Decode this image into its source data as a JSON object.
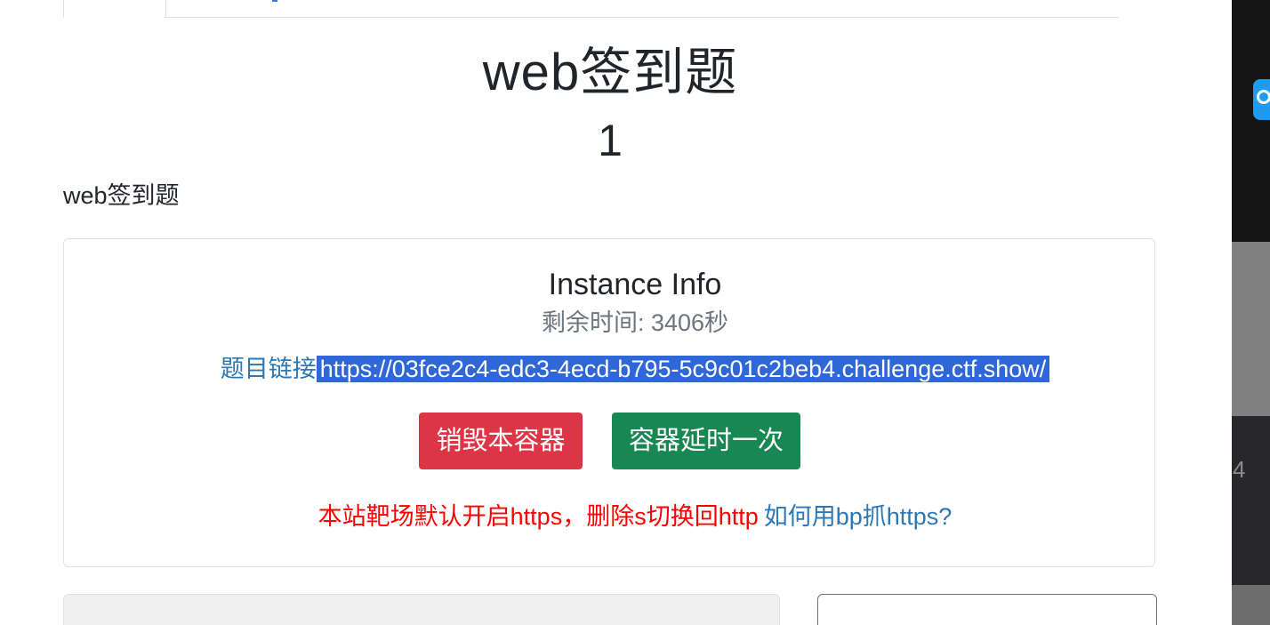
{
  "challenge": {
    "title": "web签到题",
    "value": "1",
    "description": "web签到题"
  },
  "instance": {
    "heading": "Instance Info",
    "remaining": "剩余时间: 3406秒",
    "link_label": "题目链接",
    "link_url": "https://03fce2c4-edc3-4ecd-b795-5c9c01c2beb4.challenge.ctf.show/",
    "destroy_button": "销毁本容器",
    "extend_button": "容器延时一次",
    "notice": "本站靶场默认开启https，删除s切换回http",
    "help_link": "如何用bp抓https?"
  },
  "side_strip": {
    "number": "4"
  },
  "colors": {
    "danger": "#dc3545",
    "success": "#198754",
    "link": "#2c78b7",
    "notice": "#ff0000",
    "selection": "#2f67d6"
  }
}
